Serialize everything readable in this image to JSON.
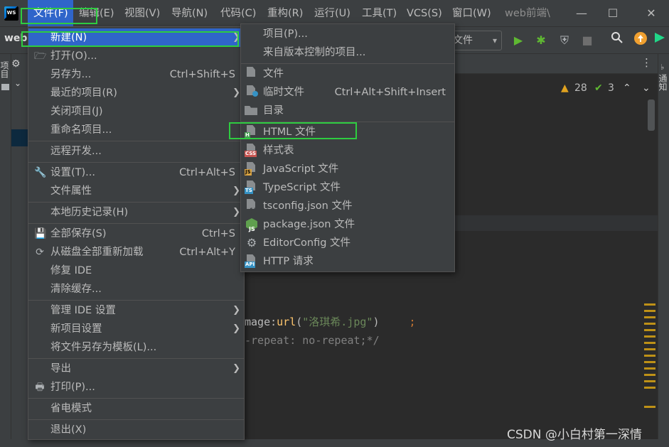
{
  "menubar": {
    "items": [
      "文件(F)",
      "编辑(E)",
      "视图(V)",
      "导航(N)",
      "代码(C)",
      "重构(R)",
      "运行(U)",
      "工具(T)",
      "VCS(S)",
      "窗口(W)"
    ],
    "project_title": "web前端\\",
    "minimize": "—",
    "maximize": "☐",
    "close": "✕",
    "logo_text": "WS"
  },
  "toolbar": {
    "project_name": "web",
    "run_config": "文件"
  },
  "side": {
    "left_tab": "项目",
    "right_tab": "通知"
  },
  "inspections": {
    "warnings": "28",
    "weak_warnings": "3"
  },
  "editor": {
    "line1_a": "mage:",
    "line1_b": "url",
    "line1_c": "(",
    "line1_d": "\"洛琪希.jpg\"",
    "line1_e": ")",
    "line1_f": ";",
    "line2": "-repeat: no-repeat;*/"
  },
  "file_menu": {
    "new": "新建(N)",
    "open": "打开(O)...",
    "save_as": "另存为...",
    "save_as_shortcut": "Ctrl+Shift+S",
    "recent": "最近的项目(R)",
    "close_project": "关闭项目(J)",
    "rename_project": "重命名项目...",
    "remote_dev": "远程开发...",
    "settings": "设置(T)...",
    "settings_shortcut": "Ctrl+Alt+S",
    "file_props": "文件属性",
    "local_history": "本地历史记录(H)",
    "save_all": "全部保存(S)",
    "save_all_shortcut": "Ctrl+S",
    "reload": "从磁盘全部重新加载",
    "reload_shortcut": "Ctrl+Alt+Y",
    "repair_ide": "修复 IDE",
    "clear_cache": "清除缓存...",
    "manage_ide": "管理 IDE 设置",
    "new_project_settings": "新项目设置",
    "save_as_template": "将文件另存为模板(L)...",
    "export": "导出",
    "print": "打印(P)...",
    "power_save": "省电模式",
    "exit": "退出(X)"
  },
  "new_menu": {
    "project": "项目(P)...",
    "from_vcs": "来自版本控制的项目...",
    "file": "文件",
    "scratch": "临时文件",
    "scratch_shortcut": "Ctrl+Alt+Shift+Insert",
    "directory": "目录",
    "html": "HTML 文件",
    "stylesheet": "样式表",
    "javascript": "JavaScript 文件",
    "typescript": "TypeScript 文件",
    "tsconfig": "tsconfig.json 文件",
    "package_json": "package.json 文件",
    "editorconfig": "EditorConfig 文件",
    "http": "HTTP 请求"
  },
  "icons": {
    "css_tag": "CSS",
    "js_tag": "JS",
    "ts_tag": "TS",
    "api_tag": "API",
    "h_tag": "H"
  },
  "watermark": "CSDN @小白村第一深情",
  "colors": {
    "highlight": "#2f65ca",
    "annotation": "#2ecc40",
    "warning": "#e0a21f",
    "ok": "#5fb832"
  }
}
